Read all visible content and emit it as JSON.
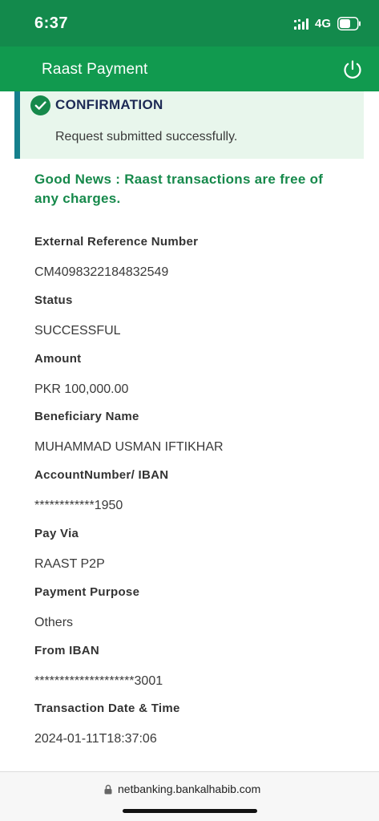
{
  "status_bar": {
    "time": "6:37",
    "network": "4G",
    "icons": [
      "signal-icon",
      "battery-icon"
    ]
  },
  "app_bar": {
    "title": "Raast Payment",
    "icons": [
      "power-icon"
    ]
  },
  "confirmation": {
    "title": "CONFIRMATION",
    "message": "Request submitted successfully.",
    "icon": "check-circle-icon"
  },
  "notice": "Good News : Raast transactions are free of any charges.",
  "details": [
    {
      "label": "External Reference Number",
      "value": "CM4098322184832549"
    },
    {
      "label": "Status",
      "value": "SUCCESSFUL"
    },
    {
      "label": "Amount",
      "value": "PKR 100,000.00"
    },
    {
      "label": "Beneficiary Name",
      "value": "MUHAMMAD USMAN IFTIKHAR"
    },
    {
      "label": "AccountNumber/ IBAN",
      "value": "************1950"
    },
    {
      "label": "Pay Via",
      "value": "RAAST P2P"
    },
    {
      "label": "Payment Purpose",
      "value": "Others"
    },
    {
      "label": "From IBAN",
      "value": "********************3001"
    },
    {
      "label": "Transaction Date & Time",
      "value": "2024-01-11T18:37:06"
    }
  ],
  "browser": {
    "url": "netbanking.bankalhabib.com",
    "icons": [
      "lock-icon"
    ]
  },
  "colors": {
    "primary_green": "#119a4f",
    "status_bar_green": "#138a4c",
    "banner_background": "#e8f6ec",
    "banner_accent": "#15808c",
    "notice_text": "#16894b",
    "title_navy": "#1d2a55"
  }
}
